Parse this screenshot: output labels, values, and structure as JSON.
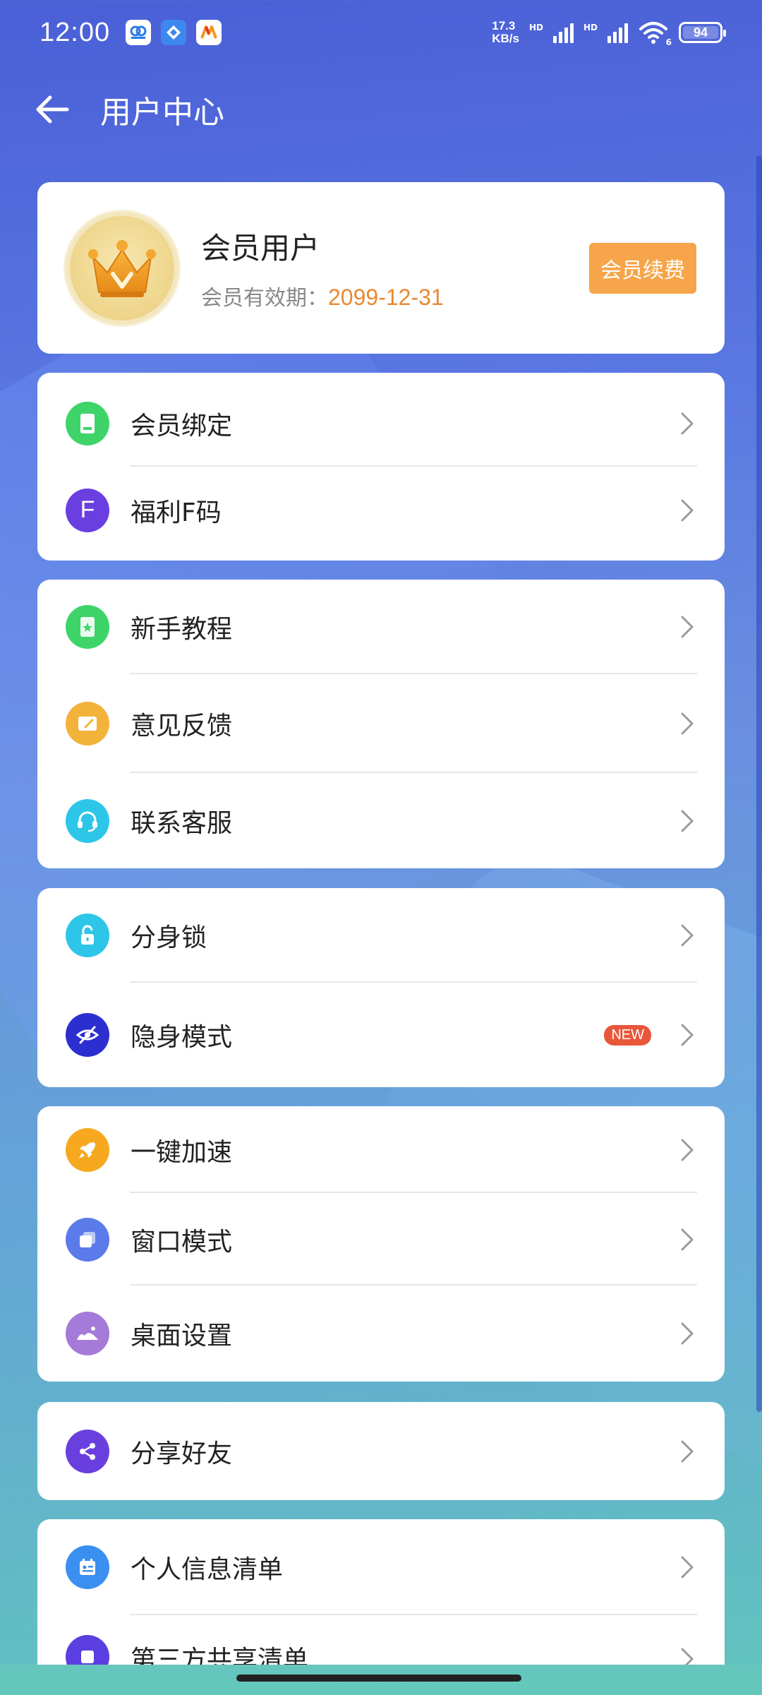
{
  "status_bar": {
    "time": "12:00",
    "net_speed_value": "17.3",
    "net_speed_unit": "KB/s",
    "hd1": "HD",
    "hd2": "HD",
    "battery": "94",
    "wifi_sub": "6"
  },
  "header": {
    "title": "用户中心"
  },
  "member": {
    "name": "会员用户",
    "expiry_label": "会员有效期：",
    "expiry_date": "2099-12-31",
    "renew_label": "会员续费"
  },
  "groups": [
    {
      "items": [
        {
          "label": "会员绑定",
          "icon": "card-icon",
          "color": "#3ed46a"
        },
        {
          "label": "福利F码",
          "icon": "f-code-icon",
          "color": "#6a3fe0",
          "glyph": "F"
        }
      ]
    },
    {
      "items": [
        {
          "label": "新手教程",
          "icon": "tutorial-icon",
          "color": "#3ed46a"
        },
        {
          "label": "意见反馈",
          "icon": "feedback-icon",
          "color": "#f3b23a"
        },
        {
          "label": "联系客服",
          "icon": "headset-icon",
          "color": "#2ec6e8"
        }
      ]
    },
    {
      "items": [
        {
          "label": "分身锁",
          "icon": "lock-icon",
          "color": "#2ec6e8"
        },
        {
          "label": "隐身模式",
          "icon": "eye-off-icon",
          "color": "#2b2fd0",
          "badge": "NEW"
        }
      ]
    },
    {
      "items": [
        {
          "label": "一键加速",
          "icon": "rocket-icon",
          "color": "#f6a91f"
        },
        {
          "label": "窗口模式",
          "icon": "window-icon",
          "color": "#5b7bea"
        },
        {
          "label": "桌面设置",
          "icon": "landscape-icon",
          "color": "#a57ad9"
        }
      ]
    },
    {
      "items": [
        {
          "label": "分享好友",
          "icon": "share-icon",
          "color": "#6a3fe0"
        }
      ]
    },
    {
      "items": [
        {
          "label": "个人信息清单",
          "icon": "id-list-icon",
          "color": "#3b8ff0"
        },
        {
          "label": "第三方共享清单",
          "icon": "share-list-icon",
          "color": "#5b3fe0"
        }
      ]
    }
  ]
}
